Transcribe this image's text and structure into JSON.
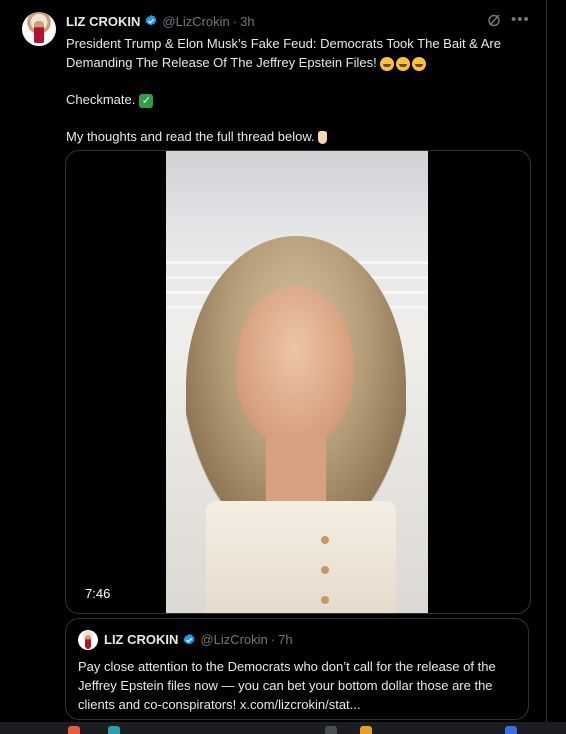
{
  "tweet": {
    "author_name": "LIZ CROKIN",
    "handle": "@LizCrokin",
    "separator": "·",
    "time": "3h",
    "text_line1": "President Trump & Elon Musk’s Fake Feud: Democrats Took The Bait & Are Demanding The Release Of The Jeffrey Epstein Files!",
    "text_line2": "Checkmate.",
    "text_line3": "My thoughts and read the full thread below.",
    "video_duration": "7:46"
  },
  "quote": {
    "author_name": "LIZ CROKIN",
    "handle": "@LizCrokin",
    "separator": "·",
    "time": "7h",
    "text": "Pay close attention to the Democrats who don’t call for the release of the Jeffrey Epstein files now — you can bet your bottom dollar those are the clients and co-conspirators! x.com/lizcrokin/stat..."
  },
  "icons": {
    "verified": "verified-badge-icon",
    "grok": "grok-icon",
    "more": "more-options-icon"
  },
  "colors": {
    "background": "#000000",
    "text": "#e7e9ea",
    "muted": "#71767b",
    "verified": "#1d9bf0",
    "border": "#2f3336"
  }
}
